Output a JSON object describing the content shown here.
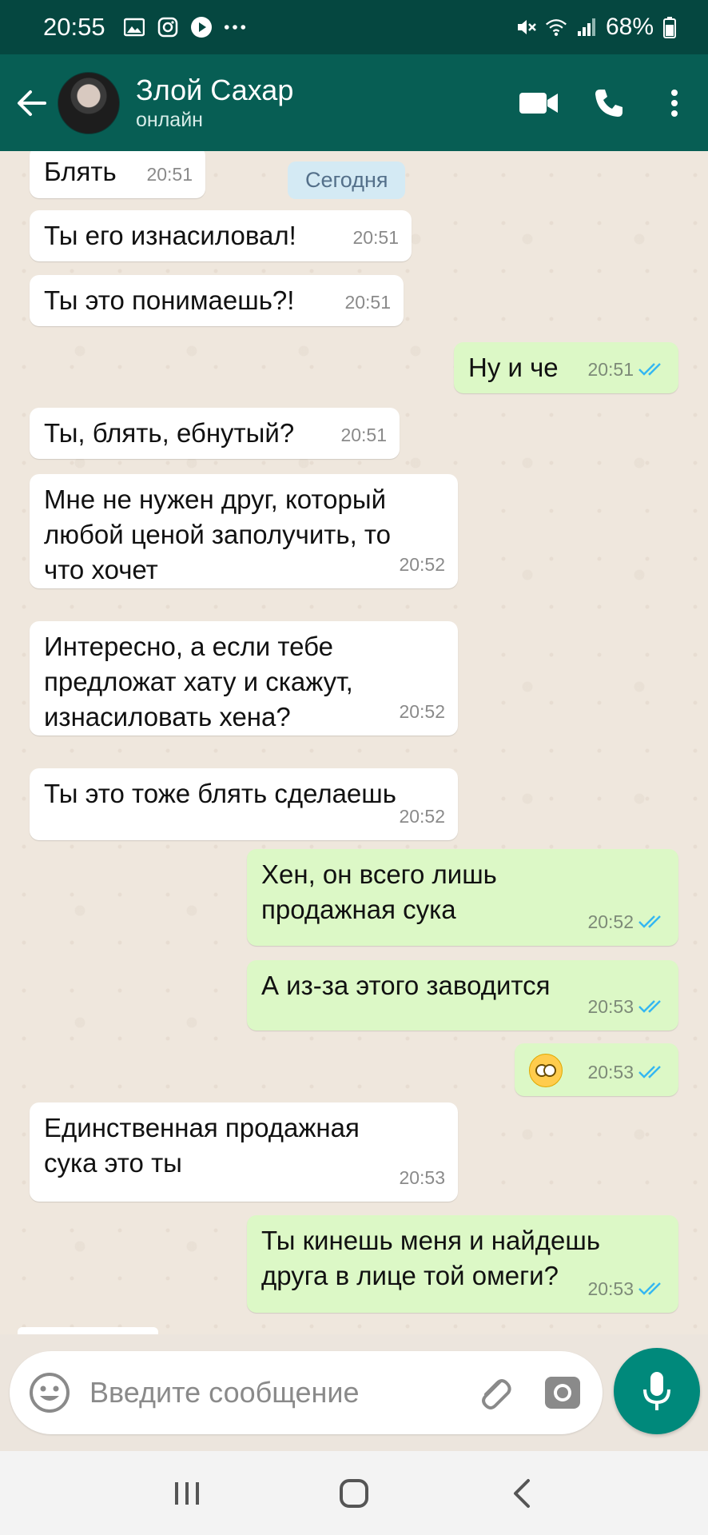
{
  "status_bar": {
    "time": "20:55",
    "battery": "68%"
  },
  "header": {
    "contact_name": "Злой Сахар",
    "contact_status": "онлайн"
  },
  "chat": {
    "date_label": "Сегодня",
    "messages": [
      {
        "dir": "in",
        "text": "Блять",
        "time": "20:51"
      },
      {
        "dir": "in",
        "text": "Ты его изнасиловал!",
        "time": "20:51"
      },
      {
        "dir": "in",
        "text": "Ты это понимаешь?!",
        "time": "20:51"
      },
      {
        "dir": "out",
        "text": "Ну и че",
        "time": "20:51"
      },
      {
        "dir": "in",
        "text": "Ты, блять, ебнутый?",
        "time": "20:51"
      },
      {
        "dir": "in",
        "text": "Мне не нужен друг, который\nлюбой ценой заполучить, то\nчто хочет",
        "time": "20:52"
      },
      {
        "dir": "in",
        "text": "Интересно, а если тебе\nпредложат хату и скажут,\nизнасиловать хена?",
        "time": "20:52"
      },
      {
        "dir": "in",
        "text": "Ты это тоже блять сделаешь",
        "time": "20:52"
      },
      {
        "dir": "out",
        "text": "Хен, он всего лишь\nпродажная сука",
        "time": "20:52"
      },
      {
        "dir": "out",
        "text": "А из-за этого заводится",
        "time": "20:53"
      },
      {
        "dir": "out",
        "text": "",
        "emoji": "face-with-rolling-eyes",
        "time": "20:53"
      },
      {
        "dir": "in",
        "text": "Единственная продажная\nсука это ты",
        "time": "20:53"
      },
      {
        "dir": "out",
        "text": "Ты кинешь меня и найдешь\nдруга в лице той омеги?",
        "time": "20:53"
      }
    ]
  },
  "composer": {
    "placeholder": "Введите сообщение"
  },
  "colors": {
    "header": "#075e54",
    "status_bar": "#054740",
    "outgoing": "#dcf8c6",
    "incoming": "#ffffff",
    "tick_read": "#34b7f1",
    "mic": "#00897b"
  }
}
